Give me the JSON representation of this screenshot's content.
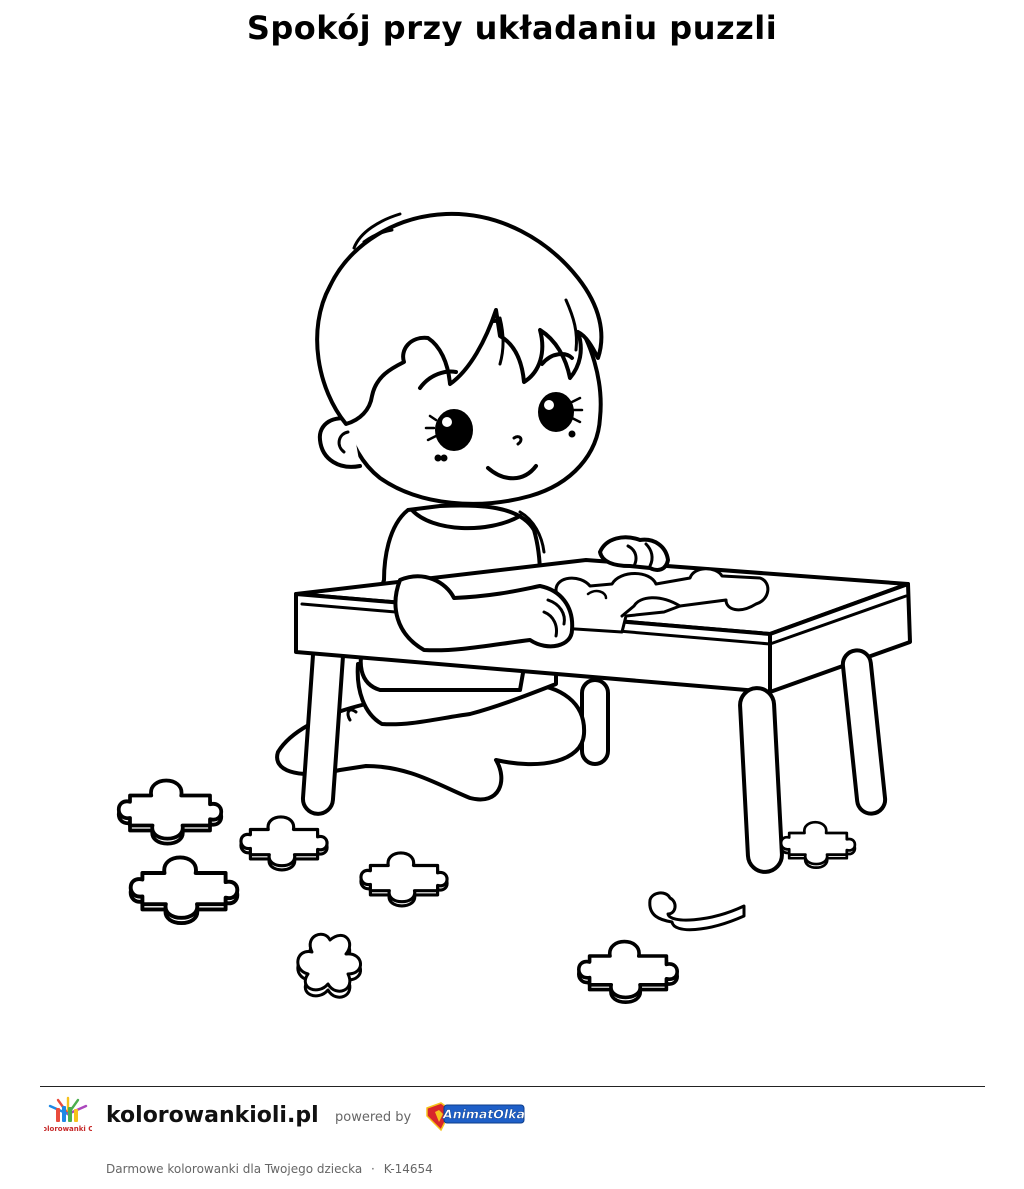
{
  "page": {
    "title": "Spokój przy układaniu puzzli"
  },
  "illustration": {
    "subject": "boy-assembling-puzzle"
  },
  "footer": {
    "site_name": "kolorowankioli.pl",
    "powered_by": "powered by",
    "partner_brand": "AnimatOlka",
    "logo_text": "Kolorowanki Oli",
    "tagline": "Darmowe kolorowanki dla Twojego dziecka",
    "separator": "·",
    "code": "K-14654",
    "colors": {
      "rule": "#222222",
      "muted_text": "#666666",
      "partner_blue": "#1e5fc8",
      "partner_red": "#d8262b",
      "partner_yellow": "#f6c21c"
    }
  }
}
